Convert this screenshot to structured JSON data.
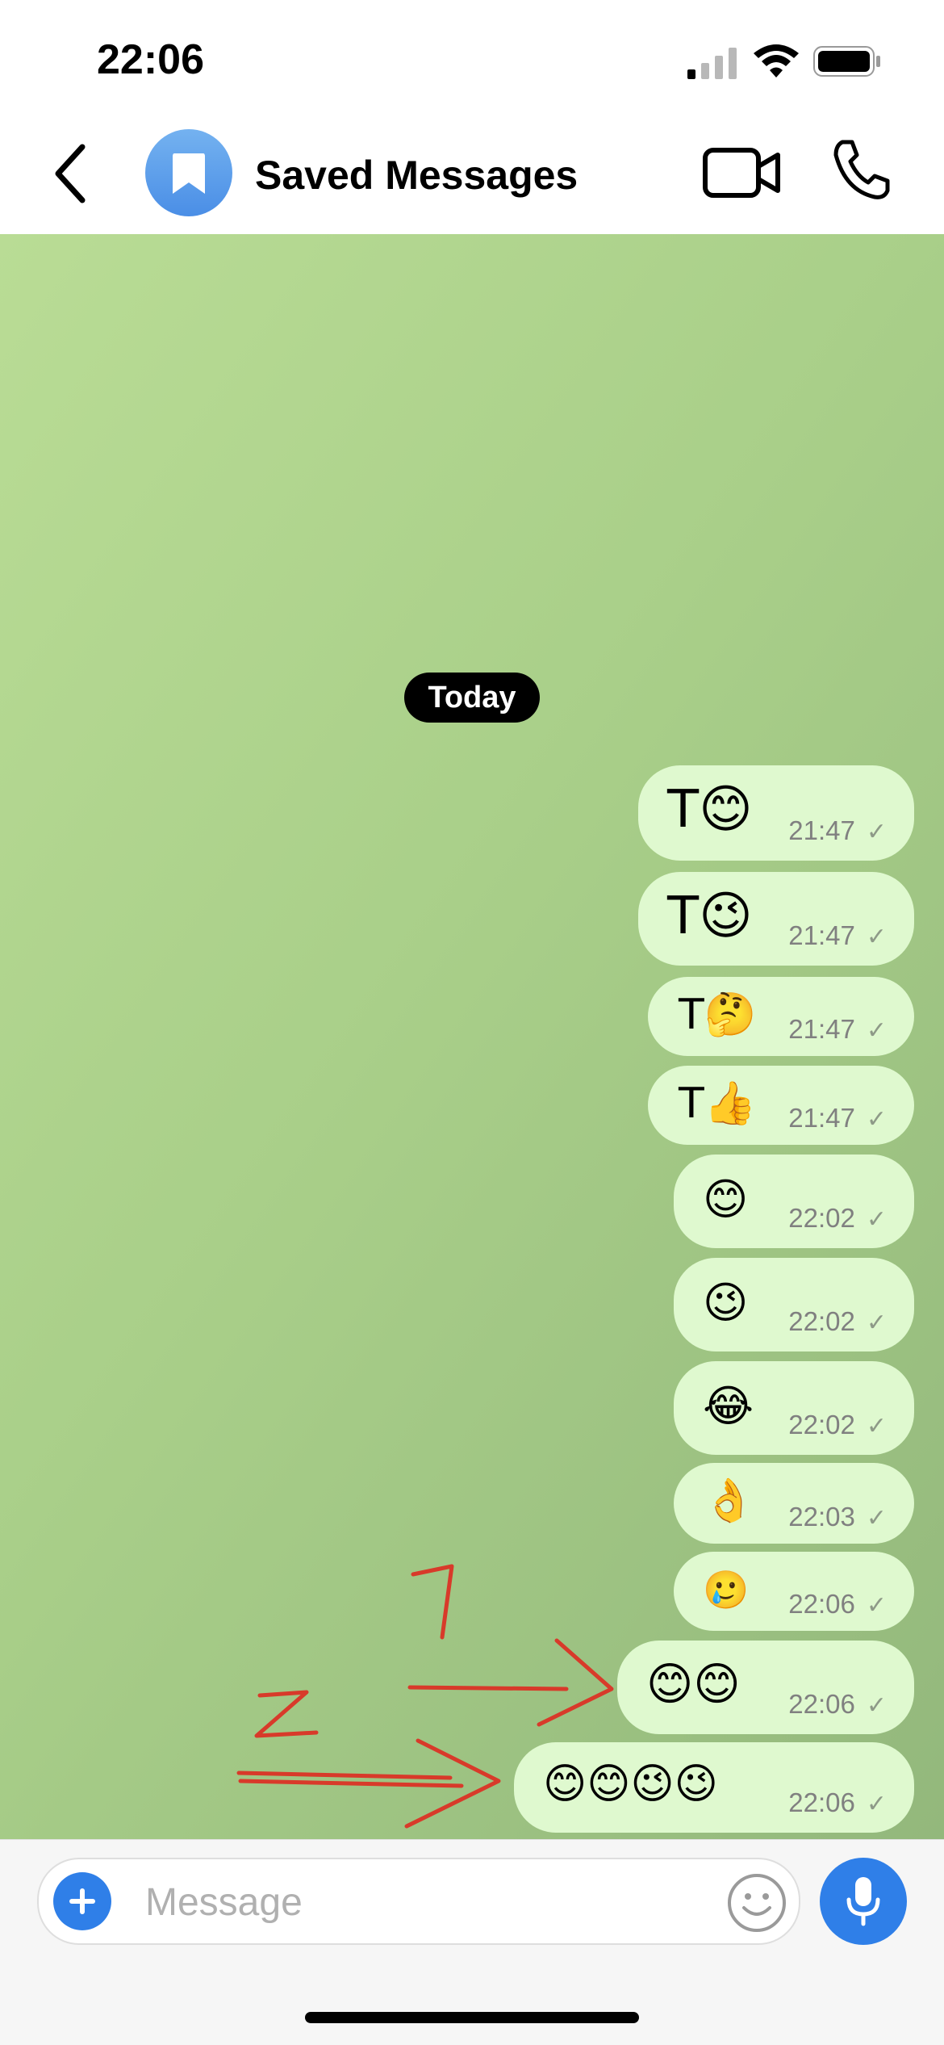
{
  "status_bar": {
    "time": "22:06"
  },
  "header": {
    "back_icon": "chevron-left-icon",
    "avatar_icon": "bookmark-icon",
    "title": "Saved Messages",
    "video_icon": "video-camera-icon",
    "call_icon": "phone-icon"
  },
  "chat": {
    "date_label": "Today",
    "messages": [
      {
        "text": "T😊",
        "time": "21:47",
        "status_icon": "check-icon"
      },
      {
        "text": "T😉",
        "time": "21:47",
        "status_icon": "check-icon"
      },
      {
        "text": "T🤔",
        "time": "21:47",
        "status_icon": "check-icon"
      },
      {
        "text": "T👍",
        "time": "21:47",
        "status_icon": "check-icon"
      },
      {
        "text": "😊",
        "time": "22:02",
        "status_icon": "check-icon"
      },
      {
        "text": "😉",
        "time": "22:02",
        "status_icon": "check-icon"
      },
      {
        "text": "😂",
        "time": "22:02",
        "status_icon": "check-icon"
      },
      {
        "text": "👌",
        "time": "22:03",
        "status_icon": "check-icon"
      },
      {
        "text": "🥲",
        "time": "22:06",
        "status_icon": "check-icon"
      },
      {
        "text": "😊😊",
        "time": "22:06",
        "status_icon": "check-icon"
      },
      {
        "text": "😊😊😉😉",
        "time": "22:06",
        "status_icon": "check-icon"
      }
    ],
    "annotations": [
      "1",
      "2"
    ]
  },
  "input": {
    "placeholder": "Message",
    "attach_icon": "plus-icon",
    "emoji_icon": "smiley-icon",
    "mic_icon": "microphone-icon"
  },
  "colors": {
    "accent": "#2f7fe8",
    "bubble": "#dff9cf",
    "annotation": "#d83a2a"
  }
}
